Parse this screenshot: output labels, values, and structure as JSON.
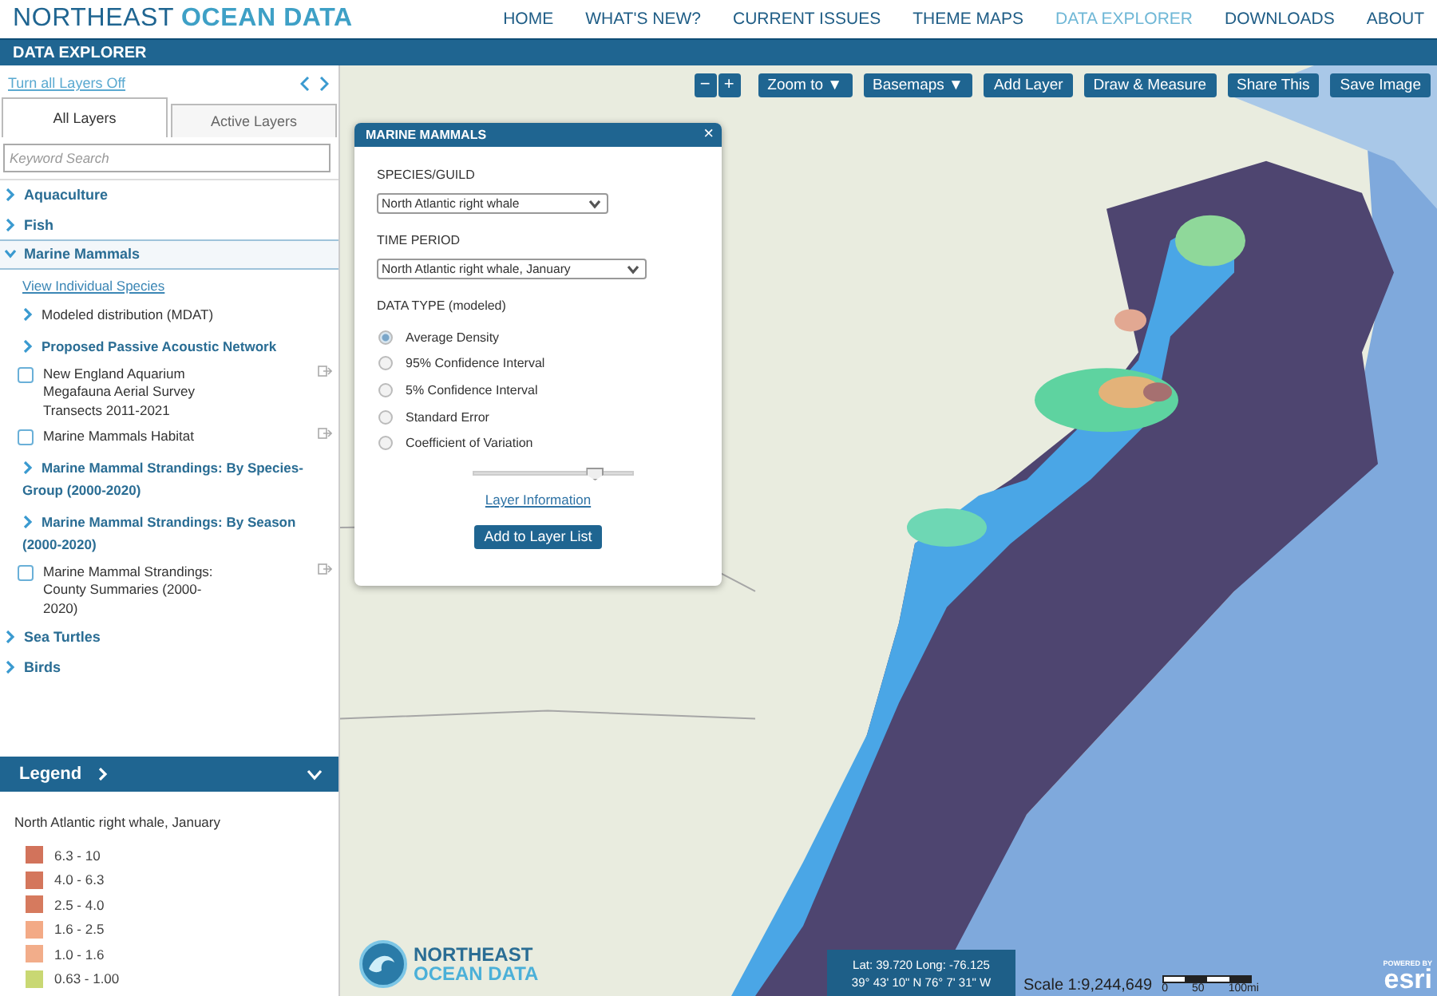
{
  "header": {
    "brand_light": "NORTHEAST",
    "brand_bold": "OCEAN DATA",
    "nav": [
      {
        "label": "HOME",
        "selected": false
      },
      {
        "label": "WHAT'S NEW?",
        "selected": false
      },
      {
        "label": "CURRENT ISSUES",
        "selected": false
      },
      {
        "label": "THEME MAPS",
        "selected": false
      },
      {
        "label": "DATA EXPLORER",
        "selected": true
      },
      {
        "label": "DOWNLOADS",
        "selected": false
      },
      {
        "label": "ABOUT",
        "selected": false
      }
    ]
  },
  "title_bar": {
    "title": "DATA EXPLORER"
  },
  "sidebar": {
    "turn_off_link": "Turn all Layers Off",
    "tabs": [
      {
        "label": "All Layers",
        "selected": true
      },
      {
        "label": "Active Layers",
        "selected": false
      }
    ],
    "search": {
      "placeholder": "Keyword Search"
    },
    "layers": [
      {
        "kind": "category",
        "label": "Aquaculture",
        "expanded": false
      },
      {
        "kind": "category",
        "label": "Fish",
        "expanded": false
      },
      {
        "kind": "category",
        "label": "Marine Mammals",
        "expanded": true,
        "children": [
          {
            "kind": "link",
            "label": "View Individual Species"
          },
          {
            "kind": "plain-group",
            "label": "Modeled distribution (MDAT)"
          },
          {
            "kind": "group",
            "label": "Proposed Passive Acoustic Network"
          },
          {
            "kind": "checkbox",
            "label": "New England Aquarium Megafauna Aerial Survey Transects 2011-2021",
            "checked": false
          },
          {
            "kind": "checkbox",
            "label": "Marine Mammals Habitat",
            "checked": false
          },
          {
            "kind": "group",
            "label": "Marine Mammal Strandings: By Species-Group (2000-2020)"
          },
          {
            "kind": "group",
            "label": "Marine Mammal Strandings: By Season (2000-2020)"
          },
          {
            "kind": "checkbox",
            "label": "Marine Mammal Strandings: County Summaries (2000-2020)",
            "checked": false
          }
        ]
      },
      {
        "kind": "category",
        "label": "Sea Turtles",
        "expanded": false
      },
      {
        "kind": "category",
        "label": "Birds",
        "expanded": false
      }
    ],
    "legend": {
      "title": "Legend",
      "layer_name": "North Atlantic right whale, January",
      "items": [
        {
          "label": "6.3 - 10",
          "color": "#d2735b"
        },
        {
          "label": "4.0 - 6.3",
          "color": "#d4765c"
        },
        {
          "label": "2.5 - 4.0",
          "color": "#d67a5e"
        },
        {
          "label": "1.6 - 2.5",
          "color": "#f3aa86"
        },
        {
          "label": "1.0 - 1.6",
          "color": "#f2ad8a"
        },
        {
          "label": "0.63 - 1.00",
          "color": "#c9d873"
        }
      ]
    }
  },
  "map": {
    "toolbar": [
      {
        "label": "−",
        "kind": "zoom"
      },
      {
        "label": "+",
        "kind": "zoom"
      },
      {
        "label": "Zoom to ▼",
        "kind": "tool"
      },
      {
        "label": "Basemaps ▼",
        "kind": "tool"
      },
      {
        "label": "Add Layer",
        "kind": "tool"
      },
      {
        "label": "Draw & Measure",
        "kind": "tool"
      },
      {
        "label": "Share This",
        "kind": "tool"
      },
      {
        "label": "Save Image",
        "kind": "tool"
      }
    ],
    "popup": {
      "title": "MARINE MAMMALS",
      "close": "×",
      "species_label": "SPECIES/GUILD",
      "species_value": "North Atlantic right whale",
      "period_label": "TIME PERIOD",
      "period_value": "North Atlantic right whale, January",
      "data_type_label": "DATA TYPE (modeled)",
      "options": [
        {
          "label": "Average Density",
          "selected": true
        },
        {
          "label": "95% Confidence Interval",
          "selected": false
        },
        {
          "label": "5% Confidence Interval",
          "selected": false
        },
        {
          "label": "Standard Error",
          "selected": false
        },
        {
          "label": "Coefficient of Variation",
          "selected": false
        }
      ],
      "opacity": {
        "level": 0.76
      },
      "info_link": "Layer Information",
      "add_button": "Add to Layer List"
    },
    "logo": {
      "line1": "NORTHEAST",
      "line2": "OCEAN DATA"
    },
    "coordinates": {
      "decimal": "Lat: 39.720 Long: -76.125",
      "dms": "39° 43' 10\" N 76° 7' 31\" W"
    },
    "scale": {
      "text": "Scale 1:9,244,649",
      "ticks": [
        "0",
        "50",
        "100mi"
      ]
    },
    "attribution": {
      "small": "POWERED BY",
      "large": "esri"
    }
  }
}
